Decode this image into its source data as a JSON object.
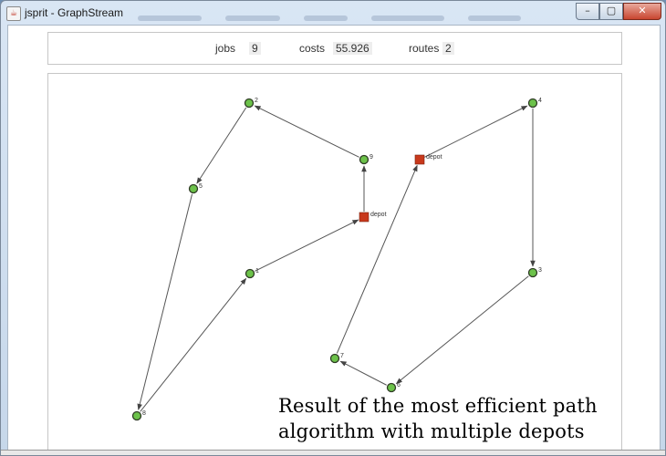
{
  "window": {
    "title": "jsprit - GraphStream",
    "app_icon": "java-cup-icon",
    "minimize_icon": "–",
    "maximize_icon": "▢",
    "close_icon": "✕"
  },
  "stats": {
    "jobs_label": "jobs",
    "jobs_value": "9",
    "costs_label": "costs",
    "costs_value": "55.926",
    "routes_label": "routes",
    "routes_value": "2"
  },
  "graph": {
    "node_color": "#6cc24a",
    "depot_color": "#c8391c",
    "edge_color": "#555555",
    "nodes": [
      {
        "id": "2",
        "label": "2",
        "type": "service"
      },
      {
        "id": "5",
        "label": "5",
        "type": "service"
      },
      {
        "id": "8",
        "label": "8",
        "type": "service"
      },
      {
        "id": "1",
        "label": "1",
        "type": "service"
      },
      {
        "id": "9",
        "label": "9",
        "type": "service"
      },
      {
        "id": "4",
        "label": "4",
        "type": "service"
      },
      {
        "id": "3",
        "label": "3",
        "type": "service"
      },
      {
        "id": "6",
        "label": "6",
        "type": "service"
      },
      {
        "id": "7",
        "label": "7",
        "type": "service"
      },
      {
        "id": "depot1",
        "label": "depot",
        "type": "depot"
      },
      {
        "id": "depot2",
        "label": "depot",
        "type": "depot"
      }
    ],
    "edges": [
      {
        "from": "depot1",
        "to": "9"
      },
      {
        "from": "9",
        "to": "2"
      },
      {
        "from": "2",
        "to": "5"
      },
      {
        "from": "5",
        "to": "8"
      },
      {
        "from": "8",
        "to": "1"
      },
      {
        "from": "1",
        "to": "depot1"
      },
      {
        "from": "depot2",
        "to": "4"
      },
      {
        "from": "4",
        "to": "3"
      },
      {
        "from": "3",
        "to": "6"
      },
      {
        "from": "6",
        "to": "7"
      },
      {
        "from": "7",
        "to": "depot2"
      }
    ]
  },
  "caption": {
    "line1": "Result of the most efficient path",
    "line2": "algorithm with multiple depots"
  }
}
